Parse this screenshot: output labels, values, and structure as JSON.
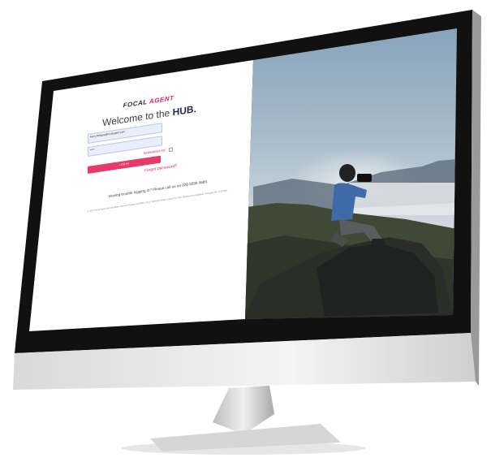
{
  "brand": {
    "logo_part1": "FOCAL",
    "logo_part2": "AGENT"
  },
  "login": {
    "welcome_prefix": "Welcome to the",
    "welcome_strong": "HUB.",
    "email_value": "kerry.hodges@focalagent.com",
    "password_value": "•••••",
    "remember_label": "REMEMBER ME",
    "login_button": "LOG IN",
    "forgot_link": "Forgot password?",
    "trouble_text": "Having trouble logging in? Please call us on 020 3598 9689.",
    "legal_text": "© 2019 Focal Agent Ltd. All rights reserved. Registered Office: 20-22 Wenlock Road, London N1 7GU. Registered in England. Company No. 07979697"
  },
  "colors": {
    "accent": "#e0245e",
    "navy": "#1f2a44",
    "field_bg": "#e8eefc"
  }
}
